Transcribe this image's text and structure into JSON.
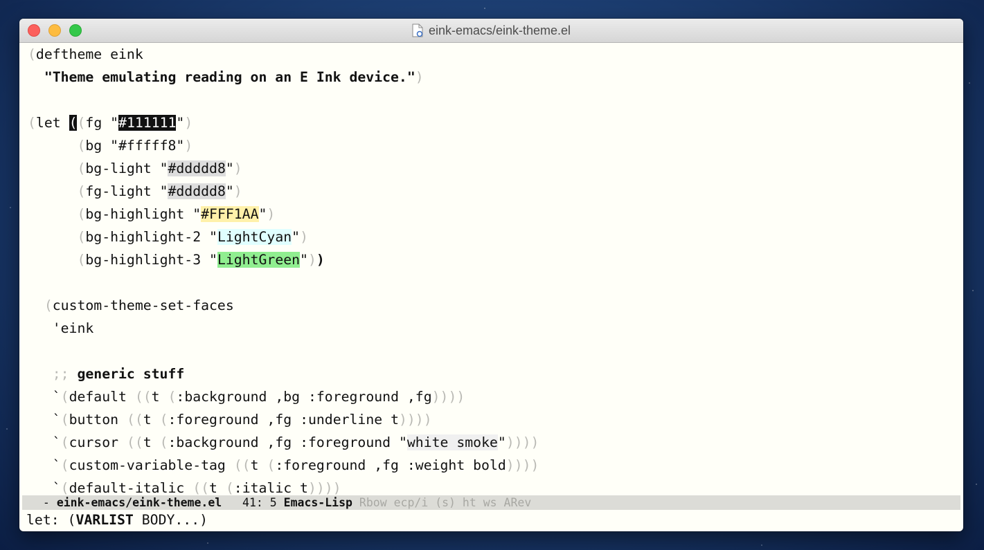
{
  "window": {
    "title": "eink-emacs/eink-theme.el",
    "file_icon": "document-icon"
  },
  "code": {
    "l1_kw": "deftheme eink",
    "l2_doc": "\"Theme emulating reading on an E Ink device.\"",
    "l3_let": "let ",
    "fg_name": "fg \"",
    "fg_val": "#111111",
    "bg_name": "bg \"#fffff8\"",
    "bg_light_name": "bg-light \"",
    "bg_light_val": "#ddddd8",
    "fg_light_name": "fg-light \"",
    "fg_light_val": "#ddddd8",
    "bg_hl_name": "bg-highlight \"",
    "bg_hl_val": "#FFF1AA",
    "bg_hl2_name": "bg-highlight-2 \"",
    "bg_hl2_val": "LightCyan",
    "bg_hl3_name": "bg-highlight-3 \"",
    "bg_hl3_val": "LightGreen",
    "custom_faces": "custom-theme-set-faces",
    "quote_eink": "'eink",
    "comment_marker": ";; ",
    "comment_text": "generic stuff",
    "default_face": "default ",
    "default_body": "t ",
    "default_attrs": ":background ,bg :foreground ,fg",
    "button_face": "button ",
    "button_body": "t ",
    "button_attrs": ":foreground ,fg :underline t",
    "cursor_face": "cursor ",
    "cursor_body": "t ",
    "cursor_attrs": ":background ,fg :foreground \"",
    "cursor_val": "white smoke",
    "cvt_face": "custom-variable-tag ",
    "cvt_body": "t ",
    "cvt_attrs": ":foreground ,fg :weight bold",
    "di_face": "default-italic ",
    "di_body": "t ",
    "di_attrs": ":italic t"
  },
  "modeline": {
    "status": " - ",
    "buffer": "eink-emacs/eink-theme.el",
    "position": "   41: 5 ",
    "mode": "Emacs-Lisp",
    "minor_modes": " Rbow ecp/i (s) ht ws ARev"
  },
  "minibuffer": {
    "prefix": "let: (",
    "varlist": "VARLIST",
    "rest": " BODY...)"
  },
  "colors": {
    "fg": "#111111",
    "bg": "#fffff8",
    "bg_light": "#ddddd8",
    "highlight": "#FFF1AA",
    "cyan": "#E0FFFF",
    "green": "#90EE90"
  }
}
